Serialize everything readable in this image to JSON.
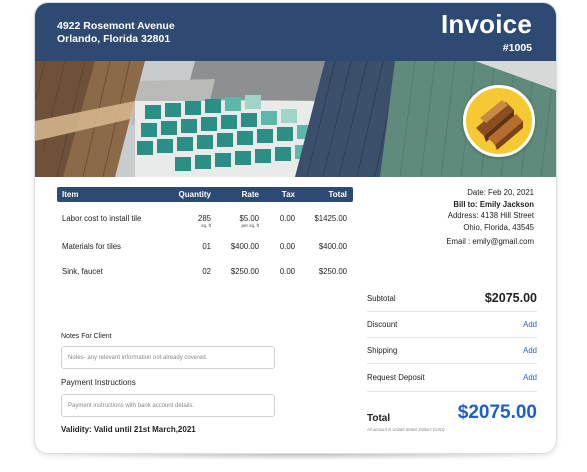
{
  "header": {
    "address_line1": "4922 Rosemont Avenue",
    "address_line2": "Orlando, Florida 32801",
    "title": "Invoice",
    "number": "#1005",
    "bg_color": "#2e4a72"
  },
  "table": {
    "columns": [
      "Item",
      "Quantity",
      "Rate",
      "Tax",
      "Total"
    ],
    "rows": [
      {
        "item": "Labor cost to install tile",
        "quantity": "285",
        "quantity_unit": "sq. ft",
        "rate": "$5.00",
        "rate_unit": "per sq. ft",
        "tax": "0.00",
        "total": "$1425.00"
      },
      {
        "item": "Materials for tiles",
        "quantity": "01",
        "quantity_unit": "",
        "rate": "$400.00",
        "rate_unit": "",
        "tax": "0.00",
        "total": "$400.00"
      },
      {
        "item": "Sink, faucet",
        "quantity": "02",
        "quantity_unit": "",
        "rate": "$250.00",
        "rate_unit": "",
        "tax": "0.00",
        "total": "$250.00"
      }
    ]
  },
  "billto": {
    "date": "Date: Feb 20, 2021",
    "bill_to_label": "Bill to:",
    "bill_to_name": "Emily Jackson",
    "address_line1": "Address: 4138 Hill Street",
    "address_line2": "Ohio, Florida, 43545",
    "email": "Email : emily@gmail.com"
  },
  "summary": {
    "subtotal_label": "Subtotal",
    "subtotal_value": "$2075.00",
    "discount_label": "Discount",
    "discount_action": "Add",
    "shipping_label": "Shipping",
    "shipping_action": "Add",
    "deposit_label": "Request Deposit",
    "deposit_action": "Add",
    "total_label": "Total",
    "total_value": "$2075.00",
    "currency_note": "All amount in United States Dollars (USD)",
    "accent_color": "#1b5fd0"
  },
  "notes": {
    "client_label": "Notes For Client",
    "client_placeholder": "Notes- any relevant information not already covered.",
    "payment_label": "Payment Instructions",
    "payment_placeholder": "Payment instructions with bank account details.",
    "validity": "Validity: Valid until 21st March,2021"
  },
  "logo": {
    "icon": "wood-planks-icon",
    "bg_color": "#f6c933"
  }
}
